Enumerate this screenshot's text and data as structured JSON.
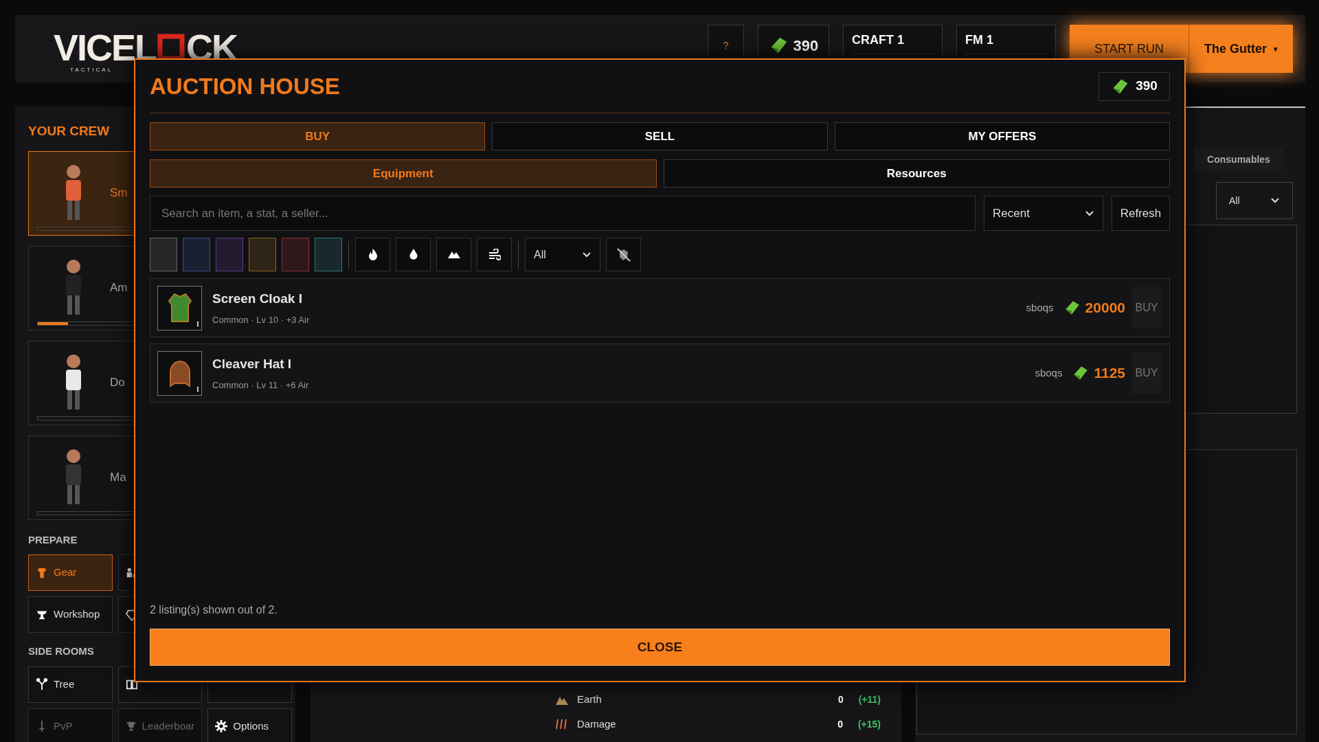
{
  "header": {
    "logo": {
      "left": "VICEL",
      "right": "CK",
      "tagline": "TACTICAL"
    },
    "help": "?",
    "currency": "390",
    "counters": [
      {
        "label": "CRAFT 1",
        "level": 0
      },
      {
        "label": "FM 1",
        "level": 0
      }
    ],
    "start_run": "START RUN",
    "map": {
      "label": "The Gutter",
      "caret": "▾"
    }
  },
  "sidebar": {
    "crew_title": "YOUR CREW",
    "crew": [
      {
        "name": "Sm",
        "selected": true,
        "level": 0
      },
      {
        "name": "Am",
        "selected": false,
        "level": 0.13
      },
      {
        "name": "Do",
        "selected": false,
        "level": 0
      },
      {
        "name": "Ma",
        "selected": false,
        "level": 0
      }
    ],
    "prepare_title": "PREPARE",
    "prepare": [
      {
        "label": "Gear",
        "selected": true
      },
      {
        "selected": false
      },
      {
        "label": "Workshop",
        "selected": false
      },
      {
        "selected": false
      }
    ],
    "side_rooms_title": "SIDE ROOMS",
    "side_rooms": [
      {
        "label": "Tree",
        "disabled": false
      },
      {
        "disabled": false
      },
      {
        "disabled": false
      },
      {
        "label": "PvP",
        "disabled": true
      },
      {
        "label": "Leaderboar",
        "disabled": true
      },
      {
        "label": "Options",
        "disabled": false
      }
    ]
  },
  "stats": [
    {
      "label": "Earth",
      "value": "0",
      "bonus": "(+11)"
    },
    {
      "label": "Damage",
      "value": "0",
      "bonus": "(+15)"
    }
  ],
  "right_panel": {
    "tab": "Consumables",
    "filter": "All"
  },
  "modal": {
    "title": "AUCTION HOUSE",
    "currency": "390",
    "tabs": [
      {
        "label": "BUY",
        "selected": true
      },
      {
        "label": "SELL",
        "selected": false
      },
      {
        "label": "MY OFFERS",
        "selected": false
      }
    ],
    "subtabs": [
      {
        "label": "Equipment",
        "selected": true
      },
      {
        "label": "Resources",
        "selected": false
      }
    ],
    "search": {
      "placeholder": "Search an item, a stat, a seller..."
    },
    "sort": "Recent",
    "refresh": "Refresh",
    "rarity_filters": [
      {
        "color": "#6a6a6e"
      },
      {
        "color": "#34508a"
      },
      {
        "color": "#5d3d86"
      },
      {
        "color": "#8a6222"
      },
      {
        "color": "#8a3036"
      },
      {
        "color": "#2f7572"
      }
    ],
    "element_select": "All",
    "listings": [
      {
        "name": "Screen Cloak I",
        "details": "Common · Lv 10 · +3 Air",
        "tier": "I",
        "seller": "sboqs",
        "price": "20000",
        "action": "BUY"
      },
      {
        "name": "Cleaver Hat I",
        "details": "Common · Lv 11 · +6 Air",
        "tier": "I",
        "seller": "sboqs",
        "price": "1125",
        "action": "BUY"
      }
    ],
    "footer": "2 listing(s) shown out of 2.",
    "close": "CLOSE"
  }
}
